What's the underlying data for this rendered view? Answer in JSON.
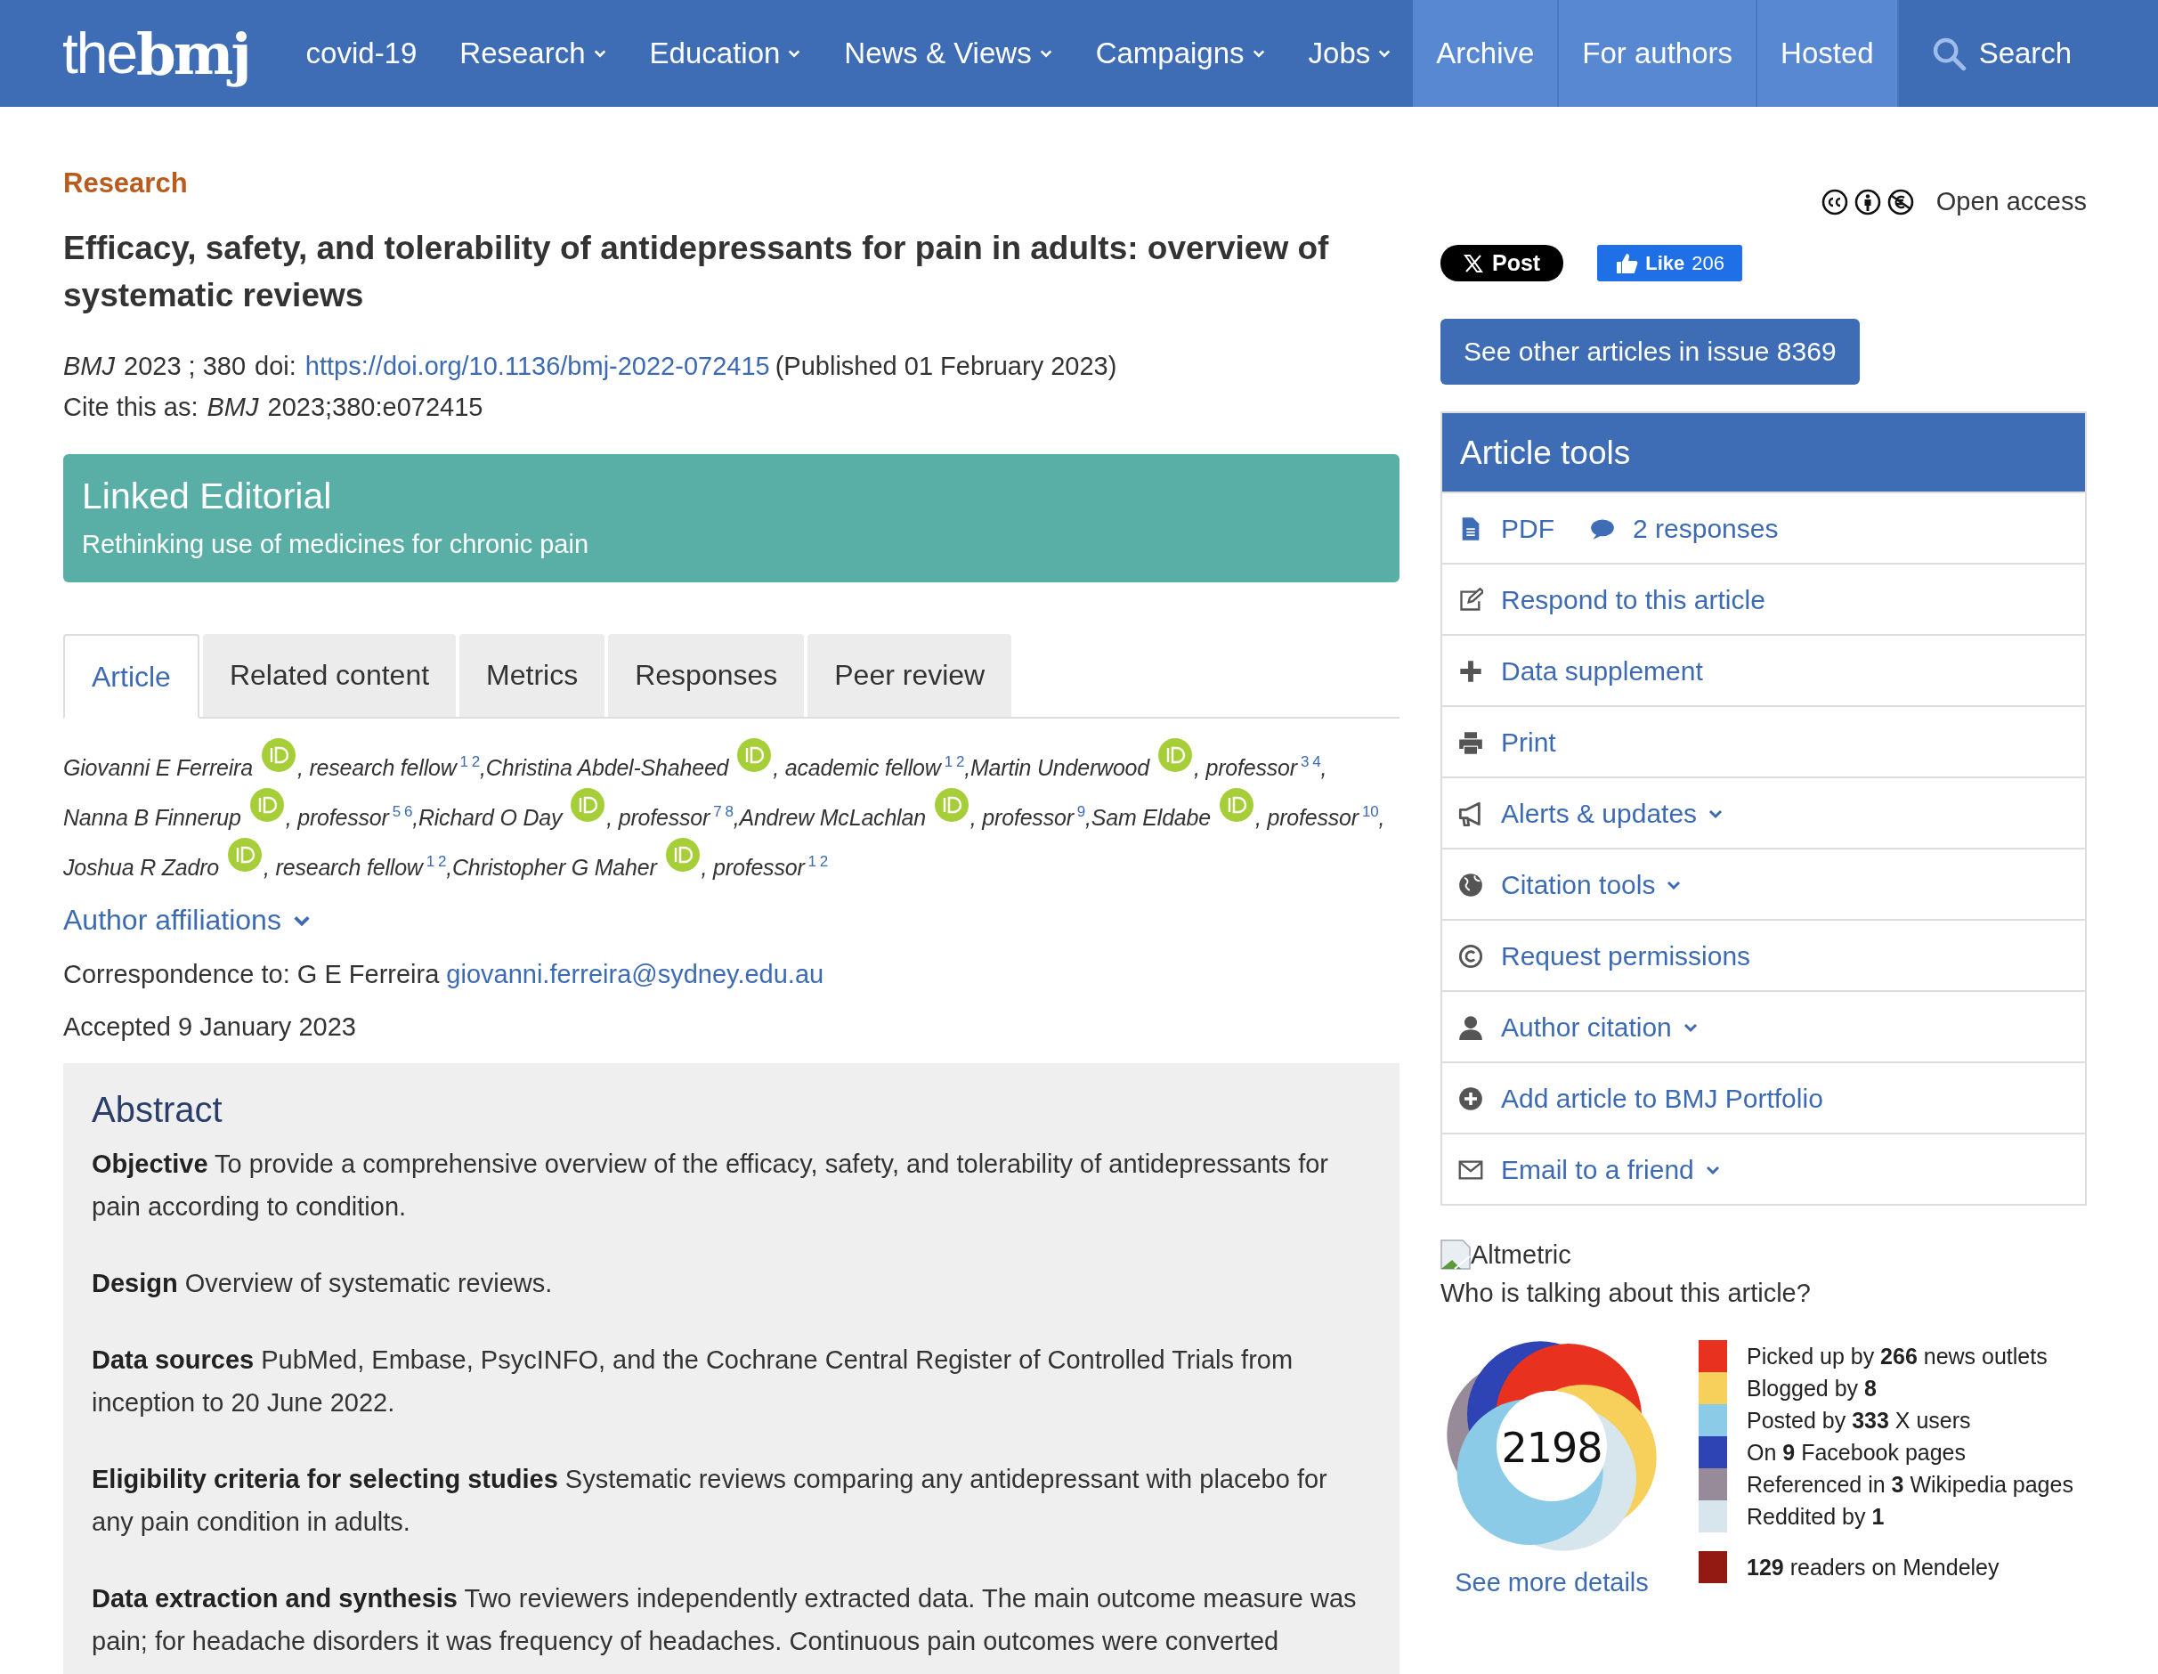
{
  "header": {
    "logo": "the**bmj**",
    "nav": [
      {
        "label": "covid-19",
        "has_menu": false,
        "highlighted": false
      },
      {
        "label": "Research",
        "has_menu": true,
        "highlighted": false
      },
      {
        "label": "Education",
        "has_menu": true,
        "highlighted": false
      },
      {
        "label": "News & Views",
        "has_menu": true,
        "highlighted": false
      },
      {
        "label": "Campaigns",
        "has_menu": true,
        "highlighted": false
      },
      {
        "label": "Jobs",
        "has_menu": true,
        "highlighted": false
      },
      {
        "label": "Archive",
        "has_menu": false,
        "highlighted": true
      },
      {
        "label": "For authors",
        "has_menu": false,
        "highlighted": true
      },
      {
        "label": "Hosted",
        "has_menu": false,
        "highlighted": true
      }
    ],
    "search": "Search"
  },
  "article": {
    "section": "Research",
    "title": "Efficacy, safety, and tolerability of antidepressants for pain in adults: overview of systematic reviews",
    "journal": "BMJ",
    "volume": "2023 ; 380",
    "doi_label": "doi:",
    "doi": "https://doi.org/10.1136/bmj-2022-072415",
    "published": "(Published 01 February 2023)",
    "cite_label": "Cite this as:",
    "cite_journal": "BMJ",
    "cite": "2023;380:e072415",
    "linked_editorial": {
      "heading": "Linked Editorial",
      "link": "Rethinking use of medicines for chronic pain"
    },
    "tabs": [
      {
        "label": "Article",
        "selected": true
      },
      {
        "label": "Related content",
        "selected": false
      },
      {
        "label": "Metrics",
        "selected": false
      },
      {
        "label": "Responses",
        "selected": false
      },
      {
        "label": "Peer review",
        "selected": false
      }
    ],
    "authors": [
      {
        "name": "Giovanni E Ferreira",
        "role": ", research fellow",
        "affiliations": [
          "1",
          "2"
        ],
        "trail": ","
      },
      {
        "name": "Christina Abdel-Shaheed",
        "role": ", academic fellow",
        "affiliations": [
          "1",
          "2"
        ],
        "trail": ","
      },
      {
        "name": "Martin Underwood",
        "role": ", professor",
        "affiliations": [
          "3",
          "4"
        ],
        "trail": ","
      },
      {
        "name": "Nanna B Finnerup",
        "role": ", professor",
        "affiliations": [
          "5",
          "6"
        ],
        "trail": ","
      },
      {
        "name": "Richard O Day",
        "role": ", professor",
        "affiliations": [
          "7",
          "8"
        ],
        "trail": ","
      },
      {
        "name": "Andrew McLachlan",
        "role": ", professor",
        "affiliations": [
          "9"
        ],
        "trail": ","
      },
      {
        "name": "Sam Eldabe",
        "role": ", professor",
        "affiliations": [
          "10"
        ],
        "trail": ","
      },
      {
        "name": "Joshua R Zadro",
        "role": ", research fellow",
        "affiliations": [
          "1",
          "2"
        ],
        "trail": ","
      },
      {
        "name": "Christopher G Maher",
        "role": ", professor",
        "affiliations": [
          "1",
          "2"
        ]
      }
    ],
    "affiliations_link": "Author affiliations",
    "correspondence_label": "Correspondence to: G E Ferreira",
    "correspondence_email": "giovanni.ferreira@sydney.edu.au",
    "accepted": "Accepted 9 January 2023",
    "abstract": {
      "heading": "Abstract",
      "sections": [
        {
          "heading": "Objective",
          "text": "To provide a comprehensive overview of the efficacy, safety, and tolerability of antidepressants for pain according to condition."
        },
        {
          "heading": "Design",
          "text": "Overview of systematic reviews."
        },
        {
          "heading": "Data sources",
          "text": "PubMed, Embase, PsycINFO, and the Cochrane Central Register of Controlled Trials from inception to 20 June 2022."
        },
        {
          "heading": "Eligibility criteria for selecting studies",
          "text": "Systematic reviews comparing any antidepressant with placebo for any pain condition in adults."
        },
        {
          "heading": "Data extraction and synthesis",
          "text": "Two reviewers independently extracted data. The main outcome measure was pain; for headache disorders it was frequency of headaches. Continuous pain outcomes were converted"
        }
      ]
    }
  },
  "sidebar": {
    "open_access": "Open access",
    "post_button": "Post",
    "like_button": {
      "label": "Like",
      "count": "206"
    },
    "issue_button": "See other articles in issue 8369",
    "article_tools": {
      "title": "Article tools",
      "rows": [
        {
          "links": [
            {
              "kind": "pdf",
              "label": "PDF",
              "has_menu": false
            },
            {
              "kind": "comment",
              "label": "2 responses",
              "has_menu": false
            }
          ]
        },
        {
          "links": [
            {
              "kind": "edit",
              "label": "Respond to this article",
              "has_menu": false
            }
          ]
        },
        {
          "links": [
            {
              "kind": "plus",
              "label": "Data supplement",
              "has_menu": false
            }
          ]
        },
        {
          "links": [
            {
              "kind": "print",
              "label": "Print",
              "has_menu": false
            }
          ]
        },
        {
          "links": [
            {
              "kind": "megaphone",
              "label": "Alerts & updates",
              "has_menu": true
            }
          ]
        },
        {
          "links": [
            {
              "kind": "globe",
              "label": "Citation tools",
              "has_menu": true
            }
          ]
        },
        {
          "links": [
            {
              "kind": "copyright",
              "label": "Request permissions",
              "has_menu": false
            }
          ]
        },
        {
          "links": [
            {
              "kind": "user",
              "label": "Author citation",
              "has_menu": true
            }
          ]
        },
        {
          "links": [
            {
              "kind": "plus-circle",
              "label": "Add article to BMJ Portfolio",
              "has_menu": false
            }
          ]
        },
        {
          "links": [
            {
              "kind": "mail",
              "label": "Email to a friend",
              "has_menu": true
            }
          ]
        }
      ]
    },
    "altmetric": {
      "image_alt": "Altmetric",
      "question": "Who is talking about this article?",
      "score": "2198",
      "details_link": "See more details",
      "legend": [
        {
          "text": "Picked up by **266** news outlets",
          "color": "#e8321f"
        },
        {
          "text": "Blogged by **8**",
          "color": "#f6d05b"
        },
        {
          "text": "Posted by **333** X users",
          "color": "#8ccbe8"
        },
        {
          "text": "On **9** Facebook pages",
          "color": "#2f44b4"
        },
        {
          "text": "Referenced in **3** Wikipedia pages",
          "color": "#978b99"
        },
        {
          "text": "Reddited by **1**",
          "color": "#d7e5ec"
        }
      ],
      "mendeley": {
        "text": "**129** readers on Mendeley",
        "color": "#921a13"
      }
    }
  }
}
